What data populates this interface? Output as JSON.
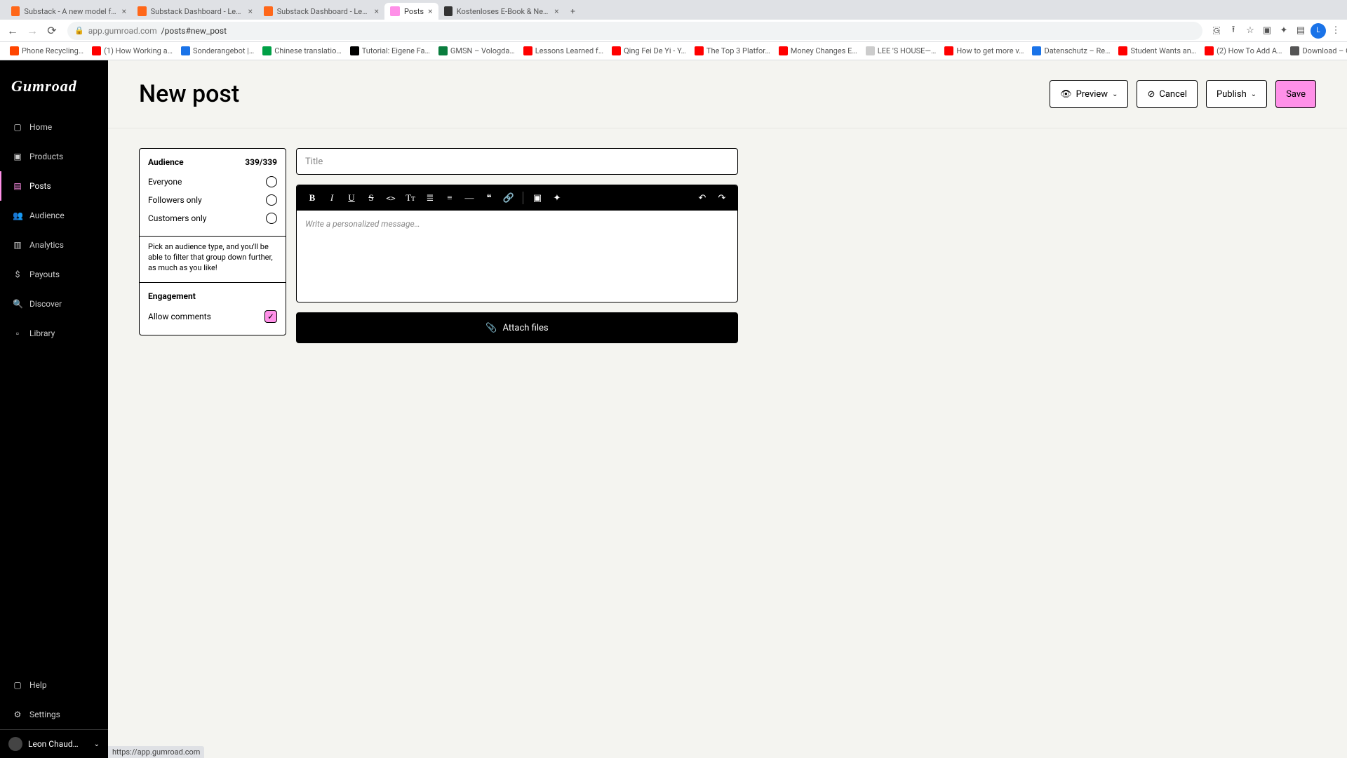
{
  "chrome": {
    "tabs": [
      {
        "title": "Substack - A new model for p…",
        "favc": "#ff6719"
      },
      {
        "title": "Substack Dashboard - Leon's…",
        "favc": "#ff6719"
      },
      {
        "title": "Substack Dashboard - Leon's…",
        "favc": "#ff6719"
      },
      {
        "title": "Posts",
        "favc": "#ff90e8",
        "active": true
      },
      {
        "title": "Kostenloses E-Book & Newsle…",
        "favc": "#333333"
      }
    ],
    "url_host": "app.gumroad.com",
    "url_path": "/posts#new_post",
    "bookmarks": [
      {
        "label": "Phone Recycling…",
        "favc": "#ff4500"
      },
      {
        "label": "(1) How Working a…",
        "favc": "#ff0000"
      },
      {
        "label": "Sonderangebot |…",
        "favc": "#1a73e8"
      },
      {
        "label": "Chinese translatio…",
        "favc": "#00a046"
      },
      {
        "label": "Tutorial: Eigene Fa…",
        "favc": "#000000"
      },
      {
        "label": "GMSN – Vologda…",
        "favc": "#0a7d3e"
      },
      {
        "label": "Lessons Learned f…",
        "favc": "#ff0000"
      },
      {
        "label": "Qing Fei De Yi - Y…",
        "favc": "#ff0000"
      },
      {
        "label": "The Top 3 Platfor…",
        "favc": "#ff0000"
      },
      {
        "label": "Money Changes E…",
        "favc": "#ff0000"
      },
      {
        "label": "LEE 'S HOUSE—…",
        "favc": "#cccccc"
      },
      {
        "label": "How to get more v…",
        "favc": "#ff0000"
      },
      {
        "label": "Datenschutz – Re…",
        "favc": "#1a73e8"
      },
      {
        "label": "Student Wants an…",
        "favc": "#ff0000"
      },
      {
        "label": "(2) How To Add A…",
        "favc": "#ff0000"
      },
      {
        "label": "Download – Cooki…",
        "favc": "#555555"
      }
    ],
    "status_url": "https://app.gumroad.com"
  },
  "brand": "Gumroad",
  "nav": {
    "items": [
      {
        "label": "Home",
        "icon": "▢"
      },
      {
        "label": "Products",
        "icon": "▣"
      },
      {
        "label": "Posts",
        "icon": "▤",
        "active": true
      },
      {
        "label": "Audience",
        "icon": "👥"
      },
      {
        "label": "Analytics",
        "icon": "▥"
      },
      {
        "label": "Payouts",
        "icon": "$"
      },
      {
        "label": "Discover",
        "icon": "🔍"
      },
      {
        "label": "Library",
        "icon": "▫"
      }
    ],
    "footer": [
      {
        "label": "Help",
        "icon": "▢"
      },
      {
        "label": "Settings",
        "icon": "⚙"
      }
    ],
    "profile": "Leon Chaud…"
  },
  "header": {
    "title": "New post",
    "preview": "Preview",
    "cancel": "Cancel",
    "publish": "Publish",
    "save": "Save"
  },
  "audience": {
    "heading": "Audience",
    "count": "339/339",
    "options": [
      "Everyone",
      "Followers only",
      "Customers only"
    ],
    "help": "Pick an audience type, and you'll be able to filter that group down further, as much as you like!"
  },
  "engagement": {
    "heading": "Engagement",
    "allow": "Allow comments"
  },
  "editor": {
    "title_placeholder": "Title",
    "body_placeholder": "Write a personalized message…",
    "attach": "Attach files",
    "tool_bold": "B",
    "tool_italic": "I",
    "tool_underline": "U",
    "tool_strike": "S",
    "tool_code": "<>",
    "tool_text": "Tт",
    "tool_ul": "≣",
    "tool_ol": "≡",
    "tool_hr": "—",
    "tool_quote": "❝",
    "tool_link": "🔗",
    "tool_image": "▣",
    "tool_embed": "✦",
    "tool_undo": "↶",
    "tool_redo": "↷"
  }
}
